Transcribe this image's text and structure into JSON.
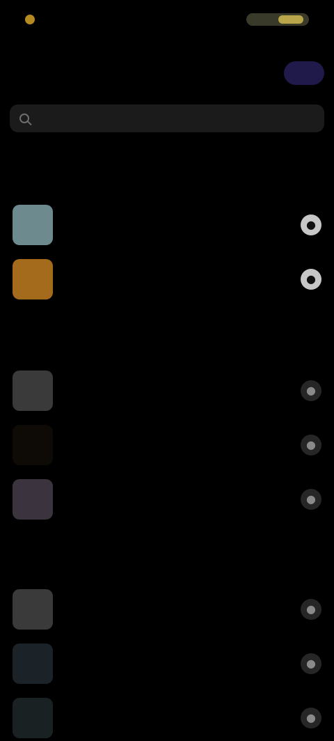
{
  "status_bar": {
    "time": "",
    "battery_fill_percent": 45,
    "icons": [
      "dot-icon",
      "battery-icon"
    ]
  },
  "header": {
    "title": "",
    "action_icon": "purple-pill-icon"
  },
  "search": {
    "placeholder": ""
  },
  "sections": [
    {
      "title": "",
      "items": [
        {
          "label": "",
          "thumb_color": "#6d8a8f",
          "action": "bright"
        },
        {
          "label": "",
          "thumb_color": "#a56b1c",
          "action": "bright"
        }
      ]
    },
    {
      "title": "",
      "items": [
        {
          "label": "",
          "thumb_color": "#6a6a6a",
          "action": "dark"
        },
        {
          "label": "",
          "thumb_color": "#1a130a",
          "action": "dark"
        },
        {
          "label": "",
          "thumb_color": "#6b5c70",
          "action": "dark"
        }
      ]
    },
    {
      "title": "",
      "items": [
        {
          "label": "",
          "thumb_color": "#6a6a6a",
          "action": "dark"
        },
        {
          "label": "",
          "thumb_color": "#314048",
          "action": "dark"
        },
        {
          "label": "",
          "thumb_color": "#2d3d3f",
          "action": "dark"
        }
      ]
    }
  ],
  "colors": {
    "background": "#000000",
    "accent_purple": "#2a1d73",
    "battery": "#b9a64a"
  }
}
